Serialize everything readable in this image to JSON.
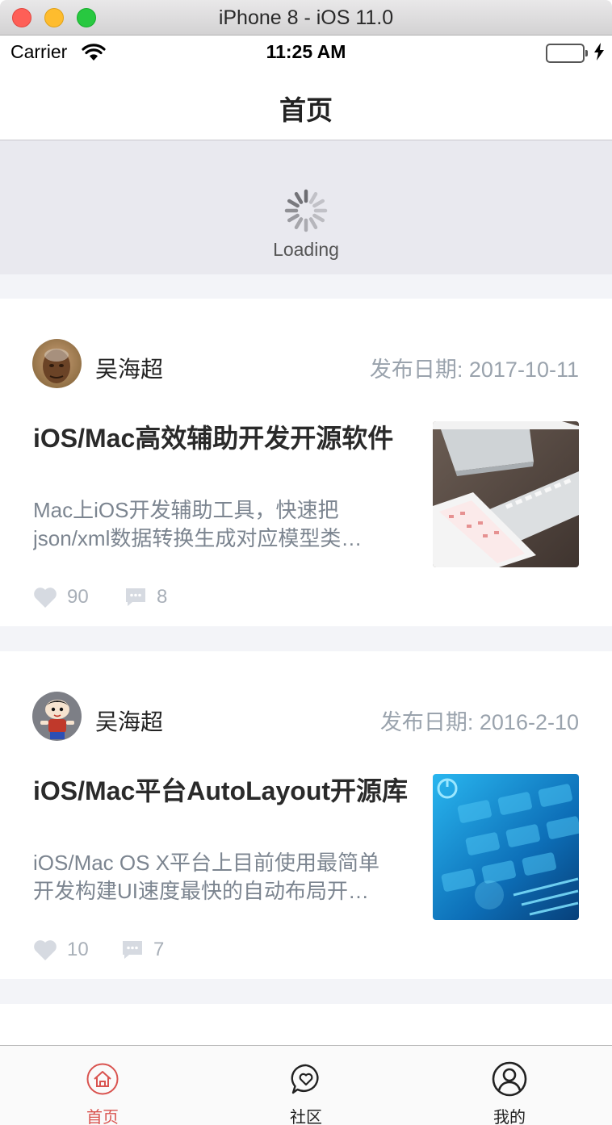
{
  "window": {
    "title": "iPhone 8 - iOS 11.0"
  },
  "status_bar": {
    "carrier": "Carrier",
    "time": "11:25 AM"
  },
  "nav": {
    "title": "首页"
  },
  "refresh": {
    "text": "Loading"
  },
  "colors": {
    "accent": "#d9534f",
    "muted": "#9aa3ad",
    "battery": "#4cd964"
  },
  "posts": [
    {
      "author": "吴海超",
      "date": "发布日期: 2017-10-11",
      "title": "iOS/Mac高效辅助开发开源软件",
      "summary": [
        "Mac上iOS开发辅助工具，快速把",
        "json/xml数据转换生成对应模型类…"
      ],
      "likes": "90",
      "comments": "8"
    },
    {
      "author": "吴海超",
      "date": "发布日期: 2016-2-10",
      "title": "iOS/Mac平台AutoLayout开源库",
      "summary": [
        "iOS/Mac OS X平台上目前使用最简单",
        "开发构建UI速度最快的自动布局开…"
      ],
      "likes": "10",
      "comments": "7"
    }
  ],
  "tabs": [
    {
      "label": "首页",
      "icon": "home-icon",
      "selected": true
    },
    {
      "label": "社区",
      "icon": "community-icon",
      "selected": false
    },
    {
      "label": "我的",
      "icon": "profile-icon",
      "selected": false
    }
  ]
}
